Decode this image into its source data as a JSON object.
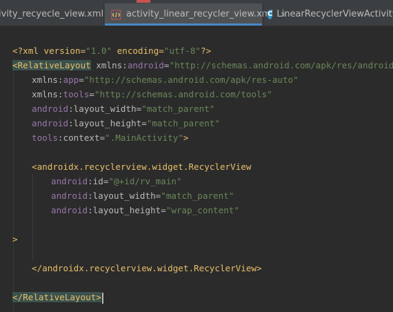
{
  "tabs": [
    {
      "label": "ivity_recyecle_view.xml",
      "close": "×"
    },
    {
      "label": "activity_linear_recycler_view.xml",
      "close": "×"
    },
    {
      "label": "LinearRecyclerViewActivity.ja",
      "close": ""
    }
  ],
  "code": {
    "l1": {
      "open": "<?xml version=",
      "v1": "\"1.0\"",
      "mid": " encoding=",
      "v2": "\"utf-8\"",
      "close": "?>"
    },
    "l2": {
      "tag": "<RelativeLayout",
      "attr": " xmlns:",
      "ns": "android",
      "eq": "=",
      "val": "\"http://schemas.android.com/apk/res/android\""
    },
    "l3": {
      "attr": "xmlns:",
      "ns": "app",
      "eq": "=",
      "val": "\"http://schemas.android.com/apk/res-auto\""
    },
    "l4": {
      "attr": "xmlns:",
      "ns": "tools",
      "eq": "=",
      "val": "\"http://schemas.android.com/tools\""
    },
    "l5": {
      "ns": "android",
      "attr": ":layout_width=",
      "val": "\"match_parent\""
    },
    "l6": {
      "ns": "android",
      "attr": ":layout_height=",
      "val": "\"match_parent\""
    },
    "l7": {
      "ns": "tools",
      "attr": ":context=",
      "val": "\".MainActivity\"",
      "tag": ">"
    },
    "l9": {
      "tag": "<androidx.recyclerview.widget.RecyclerView"
    },
    "l10": {
      "ns": "android",
      "attr": ":id=",
      "val": "\"@+id/rv_main\""
    },
    "l11": {
      "ns": "android",
      "attr": ":layout_width=",
      "val": "\"match_parent\""
    },
    "l12": {
      "ns": "android",
      "attr": ":layout_height=",
      "val": "\"wrap_content\""
    },
    "l14": {
      "tag": ">"
    },
    "l16": {
      "tag": "</androidx.recyclerview.widget.RecyclerView>"
    },
    "l18": {
      "tag": "</RelativeLayout>"
    }
  }
}
